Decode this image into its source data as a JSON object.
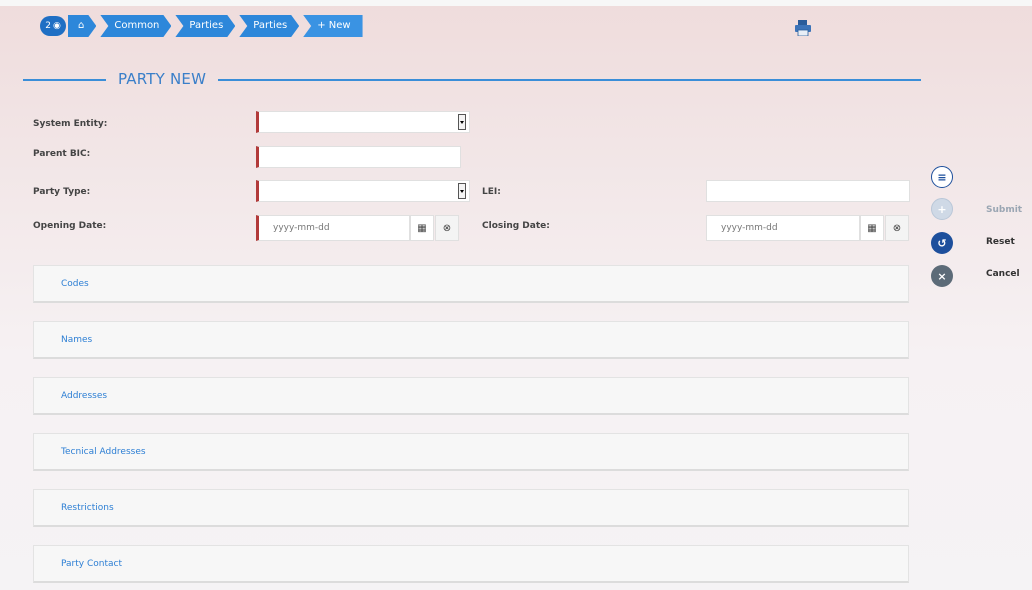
{
  "breadcrumb": {
    "badge_count": "2",
    "home_icon": "home-icon",
    "items": [
      "Common",
      "Parties",
      "Parties",
      "+ New"
    ]
  },
  "page": {
    "title": "PARTY NEW"
  },
  "form": {
    "system_entity_label": "System Entity:",
    "parent_bic_label": "Parent BIC:",
    "party_type_label": "Party Type:",
    "lei_label": "LEI:",
    "opening_date_label": "Opening Date:",
    "closing_date_label": "Closing Date:",
    "opening_date_placeholder": "yyyy-mm-dd",
    "closing_date_placeholder": "yyyy-mm-dd"
  },
  "sections": [
    "Codes",
    "Names",
    "Addresses",
    "Tecnical Addresses",
    "Restrictions",
    "Party Contact"
  ],
  "actions": {
    "submit": "Submit",
    "reset": "Reset",
    "cancel": "Cancel"
  },
  "colors": {
    "accent": "#2d87da",
    "required": "#b23a3a",
    "reset": "#1d4f9c",
    "cancel": "#5c6b78"
  }
}
